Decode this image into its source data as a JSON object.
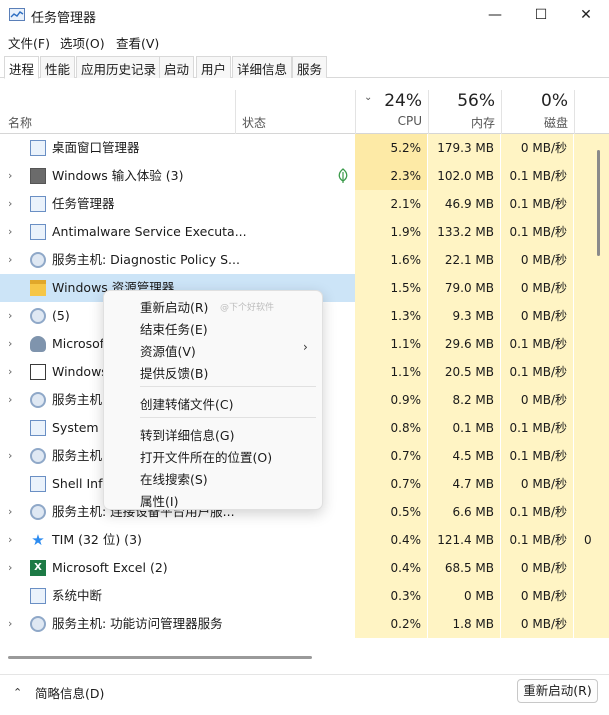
{
  "window": {
    "title": "任务管理器",
    "minimize_glyph": "—",
    "maximize_glyph": "☐",
    "close_glyph": "✕"
  },
  "menu": [
    "文件(F)",
    "选项(O)",
    "查看(V)"
  ],
  "tabs": [
    "进程",
    "性能",
    "应用历史记录",
    "启动",
    "用户",
    "详细信息",
    "服务"
  ],
  "active_tab": "进程",
  "columns": {
    "name": "名称",
    "status": "状态",
    "cpu": {
      "percent": "24%",
      "label": "CPU"
    },
    "memory": {
      "percent": "56%",
      "label": "内存"
    },
    "disk": {
      "percent": "0%",
      "label": "磁盘"
    }
  },
  "processes": [
    {
      "name": "桌面窗口管理器",
      "cpu": "5.2%",
      "mem": "179.3 MB",
      "disk": "0 MB/秒",
      "net": "",
      "icon": "window-icon",
      "expandable": false
    },
    {
      "name": "Windows 输入体验 (3)",
      "cpu": "2.3%",
      "mem": "102.0 MB",
      "disk": "0.1 MB/秒",
      "net": "",
      "icon": "keyboard-icon",
      "expandable": true,
      "suspended_leaf": true
    },
    {
      "name": "任务管理器",
      "cpu": "2.1%",
      "mem": "46.9 MB",
      "disk": "0.1 MB/秒",
      "net": "",
      "icon": "task-manager-icon",
      "expandable": true
    },
    {
      "name": "Antimalware Service Executa...",
      "cpu": "1.9%",
      "mem": "133.2 MB",
      "disk": "0.1 MB/秒",
      "net": "",
      "icon": "window-icon",
      "expandable": true
    },
    {
      "name": "服务主机: Diagnostic Policy S...",
      "cpu": "1.6%",
      "mem": "22.1 MB",
      "disk": "0 MB/秒",
      "net": "",
      "icon": "gear-icon",
      "expandable": true
    },
    {
      "name": "Windows 资源管理器",
      "cpu": "1.5%",
      "mem": "79.0 MB",
      "disk": "0 MB/秒",
      "net": "",
      "icon": "folder-icon",
      "expandable": false,
      "selected": true
    },
    {
      "name": "(5)",
      "cpu": "1.3%",
      "mem": "9.3 MB",
      "disk": "0 MB/秒",
      "net": "",
      "icon": "gear-icon",
      "expandable": true
    },
    {
      "name": "Microsof",
      "cpu": "1.1%",
      "mem": "29.6 MB",
      "disk": "0.1 MB/秒",
      "net": "",
      "icon": "user-icon",
      "expandable": true
    },
    {
      "name": "Windows",
      "cpu": "1.1%",
      "mem": "20.5 MB",
      "disk": "0.1 MB/秒",
      "net": "",
      "icon": "dark-window-icon",
      "expandable": true
    },
    {
      "name": "服务主机:",
      "cpu": "0.9%",
      "mem": "8.2 MB",
      "disk": "0 MB/秒",
      "net": "",
      "icon": "gear-icon",
      "expandable": true
    },
    {
      "name": "System",
      "cpu": "0.8%",
      "mem": "0.1 MB",
      "disk": "0.1 MB/秒",
      "net": "",
      "icon": "window-icon",
      "expandable": false
    },
    {
      "name": "服务主机:",
      "cpu": "0.7%",
      "mem": "4.5 MB",
      "disk": "0.1 MB/秒",
      "net": "",
      "icon": "gear-icon",
      "expandable": true
    },
    {
      "name": "Shell Infr",
      "cpu": "0.7%",
      "mem": "4.7 MB",
      "disk": "0 MB/秒",
      "net": "",
      "icon": "window-icon",
      "expandable": false
    },
    {
      "name": "服务主机: 连接设备平台用户服...",
      "cpu": "0.5%",
      "mem": "6.6 MB",
      "disk": "0.1 MB/秒",
      "net": "",
      "icon": "gear-icon",
      "expandable": true
    },
    {
      "name": "TIM (32 位) (3)",
      "cpu": "0.4%",
      "mem": "121.4 MB",
      "disk": "0.1 MB/秒",
      "net": "0",
      "icon": "tim-icon",
      "expandable": true
    },
    {
      "name": "Microsoft Excel (2)",
      "cpu": "0.4%",
      "mem": "68.5 MB",
      "disk": "0 MB/秒",
      "net": "",
      "icon": "excel-icon",
      "expandable": true
    },
    {
      "name": "系统中断",
      "cpu": "0.3%",
      "mem": "0 MB",
      "disk": "0 MB/秒",
      "net": "",
      "icon": "window-icon",
      "expandable": false
    },
    {
      "name": "服务主机: 功能访问管理器服务",
      "cpu": "0.2%",
      "mem": "1.8 MB",
      "disk": "0 MB/秒",
      "net": "",
      "icon": "gear-icon",
      "expandable": true
    }
  ],
  "context_menu": {
    "items": [
      "重新启动(R)",
      "结束任务(E)",
      "资源值(V)",
      "提供反馈(B)",
      "创建转储文件(C)",
      "转到详细信息(G)",
      "打开文件所在的位置(O)",
      "在线搜索(S)",
      "属性(I)"
    ],
    "submenu_arrow": "›",
    "watermark": "@下个好软件"
  },
  "footer": {
    "toggle_glyph": "⌃",
    "summary_label": "简略信息(D)",
    "action_button": "重新启动(R)"
  },
  "expand_glyph": "›",
  "sort_glyph": "⌄",
  "colors": {
    "highlight": "#fff4c4",
    "selected": "#cce4f7",
    "accent": "#0067c0"
  }
}
